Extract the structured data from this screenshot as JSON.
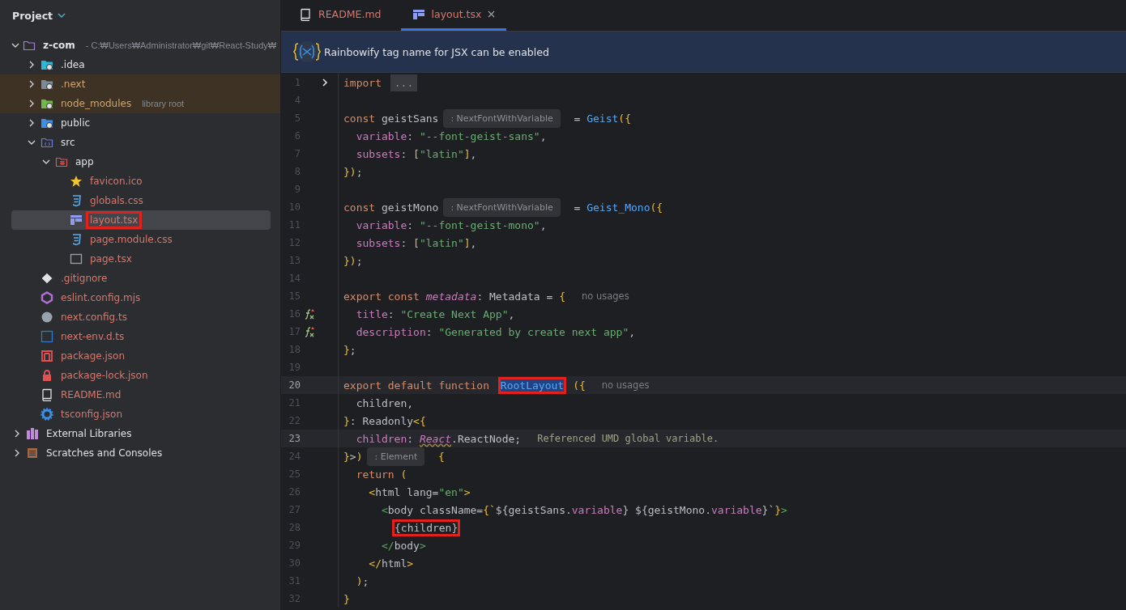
{
  "sidebar": {
    "title": "Project",
    "tree": [
      {
        "label": "z-com",
        "kind": "folder-module",
        "excluded": false,
        "untracked": false,
        "suffix": "- C:₩Users₩Administrator₩git₩React-Study₩",
        "expanded": true,
        "selected": false,
        "marked": false,
        "children": [
          {
            "label": ".idea",
            "kind": "folder-idea",
            "excluded": false,
            "untracked": false,
            "expanded": false,
            "selected": false,
            "marked": false
          },
          {
            "label": ".next",
            "kind": "folder-next",
            "excluded": true,
            "untracked": false,
            "expanded": false,
            "selected": false,
            "marked": false
          },
          {
            "label": "node_modules",
            "kind": "folder-lib",
            "excluded": true,
            "untracked": false,
            "suffix": "library root",
            "expanded": false,
            "selected": false,
            "marked": false
          },
          {
            "label": "public",
            "kind": "folder-web",
            "excluded": false,
            "untracked": false,
            "expanded": false,
            "selected": false,
            "marked": false
          },
          {
            "label": "src",
            "kind": "folder-src",
            "excluded": false,
            "untracked": false,
            "expanded": true,
            "selected": false,
            "marked": false,
            "children": [
              {
                "label": "app",
                "kind": "folder-app",
                "excluded": false,
                "untracked": false,
                "expanded": true,
                "selected": false,
                "marked": false,
                "children": [
                  {
                    "label": "favicon.ico",
                    "kind": "star",
                    "excluded": false,
                    "untracked": true,
                    "selected": false,
                    "marked": false
                  },
                  {
                    "label": "globals.css",
                    "kind": "css",
                    "excluded": false,
                    "untracked": true,
                    "selected": false,
                    "marked": false
                  },
                  {
                    "label": "layout.tsx",
                    "kind": "layout",
                    "excluded": false,
                    "untracked": true,
                    "selected": true,
                    "marked": true
                  },
                  {
                    "label": "page.module.css",
                    "kind": "css",
                    "excluded": false,
                    "untracked": true,
                    "selected": false,
                    "marked": false
                  },
                  {
                    "label": "page.tsx",
                    "kind": "page",
                    "excluded": false,
                    "untracked": true,
                    "selected": false,
                    "marked": false
                  }
                ]
              }
            ]
          },
          {
            "label": ".gitignore",
            "kind": "git",
            "excluded": false,
            "untracked": true,
            "selected": false,
            "marked": false
          },
          {
            "label": "eslint.config.mjs",
            "kind": "eslint",
            "excluded": false,
            "untracked": true,
            "selected": false,
            "marked": false
          },
          {
            "label": "next.config.ts",
            "kind": "next",
            "excluded": false,
            "untracked": true,
            "selected": false,
            "marked": false
          },
          {
            "label": "next-env.d.ts",
            "kind": "ts",
            "excluded": false,
            "untracked": true,
            "selected": false,
            "marked": false
          },
          {
            "label": "package.json",
            "kind": "npm",
            "excluded": false,
            "untracked": true,
            "selected": false,
            "marked": false
          },
          {
            "label": "package-lock.json",
            "kind": "lock",
            "excluded": false,
            "untracked": true,
            "selected": false,
            "marked": false
          },
          {
            "label": "README.md",
            "kind": "readme",
            "excluded": false,
            "untracked": true,
            "selected": false,
            "marked": false
          },
          {
            "label": "tsconfig.json",
            "kind": "tsconfig",
            "excluded": false,
            "untracked": true,
            "selected": false,
            "marked": false
          }
        ]
      },
      {
        "label": "External Libraries",
        "kind": "libraries",
        "excluded": false,
        "untracked": false,
        "expanded": false,
        "selected": false,
        "marked": false
      },
      {
        "label": "Scratches and Consoles",
        "kind": "scratches",
        "excluded": false,
        "untracked": false,
        "expanded": false,
        "selected": false,
        "marked": false
      }
    ]
  },
  "tabs": [
    {
      "label": "README.md",
      "kind": "readme",
      "selected": false,
      "closable": false
    },
    {
      "label": "layout.tsx",
      "kind": "layout",
      "selected": true,
      "closable": true
    }
  ],
  "banner": {
    "text": "Rainbowify tag name for JSX can be enabled"
  },
  "code": [
    {
      "number": "1",
      "foldable": true,
      "override": false,
      "current": false,
      "tokens": [
        {
          "kind": "kw",
          "text": "import "
        },
        {
          "kind": "fold",
          "text": "..."
        }
      ]
    },
    {
      "number": "4",
      "foldable": false,
      "override": false,
      "current": false
    },
    {
      "number": "5",
      "foldable": false,
      "override": false,
      "current": false,
      "tokens": [
        {
          "kind": "kw",
          "text": "const "
        },
        {
          "kind": "id",
          "text": "geistSans"
        },
        {
          "kind": "hint",
          "text": ": NextFontWithVariable"
        },
        {
          "kind": "id",
          "text": " = "
        },
        {
          "kind": "fn",
          "text": "Geist"
        },
        {
          "kind": "br",
          "text": "({"
        }
      ]
    },
    {
      "number": "6",
      "foldable": false,
      "override": false,
      "current": false,
      "tokens": [
        {
          "kind": "prop",
          "text": "  variable"
        },
        {
          "kind": "id",
          "text": ": "
        },
        {
          "kind": "str",
          "text": "\"--font-geist-sans\""
        },
        {
          "kind": "id",
          "text": ","
        }
      ]
    },
    {
      "number": "7",
      "foldable": false,
      "override": false,
      "current": false,
      "tokens": [
        {
          "kind": "prop",
          "text": "  subsets"
        },
        {
          "kind": "id",
          "text": ": "
        },
        {
          "kind": "br",
          "text": "["
        },
        {
          "kind": "str",
          "text": "\"latin\""
        },
        {
          "kind": "br",
          "text": "]"
        },
        {
          "kind": "id",
          "text": ","
        }
      ]
    },
    {
      "number": "8",
      "foldable": false,
      "override": false,
      "current": false,
      "tokens": [
        {
          "kind": "br",
          "text": "})"
        },
        {
          "kind": "id",
          "text": ";"
        }
      ]
    },
    {
      "number": "9",
      "foldable": false,
      "override": false,
      "current": false
    },
    {
      "number": "10",
      "foldable": false,
      "override": false,
      "current": false,
      "tokens": [
        {
          "kind": "kw",
          "text": "const "
        },
        {
          "kind": "id",
          "text": "geistMono"
        },
        {
          "kind": "hint",
          "text": ": NextFontWithVariable"
        },
        {
          "kind": "id",
          "text": " = "
        },
        {
          "kind": "fn",
          "text": "Geist_Mono"
        },
        {
          "kind": "br",
          "text": "({"
        }
      ]
    },
    {
      "number": "11",
      "foldable": false,
      "override": false,
      "current": false,
      "tokens": [
        {
          "kind": "prop",
          "text": "  variable"
        },
        {
          "kind": "id",
          "text": ": "
        },
        {
          "kind": "str",
          "text": "\"--font-geist-mono\""
        },
        {
          "kind": "id",
          "text": ","
        }
      ]
    },
    {
      "number": "12",
      "foldable": false,
      "override": false,
      "current": false,
      "tokens": [
        {
          "kind": "prop",
          "text": "  subsets"
        },
        {
          "kind": "id",
          "text": ": "
        },
        {
          "kind": "br",
          "text": "["
        },
        {
          "kind": "str",
          "text": "\"latin\""
        },
        {
          "kind": "br",
          "text": "]"
        },
        {
          "kind": "id",
          "text": ","
        }
      ]
    },
    {
      "number": "13",
      "foldable": false,
      "override": false,
      "current": false,
      "tokens": [
        {
          "kind": "br",
          "text": "})"
        },
        {
          "kind": "id",
          "text": ";"
        }
      ]
    },
    {
      "number": "14",
      "foldable": false,
      "override": false,
      "current": false
    },
    {
      "number": "15",
      "foldable": false,
      "override": false,
      "current": false,
      "tokens": [
        {
          "kind": "kw",
          "text": "export const "
        },
        {
          "kind": "it",
          "text": "metadata"
        },
        {
          "kind": "id",
          "text": ": Metadata = "
        },
        {
          "kind": "br",
          "text": "{"
        },
        {
          "kind": "usage",
          "text": "no usages"
        }
      ]
    },
    {
      "number": "16",
      "foldable": false,
      "override": true,
      "current": false,
      "tokens": [
        {
          "kind": "prop",
          "text": "  title"
        },
        {
          "kind": "id",
          "text": ": "
        },
        {
          "kind": "str",
          "text": "\"Create Next App\""
        },
        {
          "kind": "id",
          "text": ","
        }
      ]
    },
    {
      "number": "17",
      "foldable": false,
      "override": true,
      "current": false,
      "tokens": [
        {
          "kind": "prop",
          "text": "  description"
        },
        {
          "kind": "id",
          "text": ": "
        },
        {
          "kind": "str",
          "text": "\"Generated by create next app\""
        },
        {
          "kind": "id",
          "text": ","
        }
      ]
    },
    {
      "number": "18",
      "foldable": false,
      "override": false,
      "current": false,
      "tokens": [
        {
          "kind": "br",
          "text": "}"
        },
        {
          "kind": "id",
          "text": ";"
        }
      ]
    },
    {
      "number": "19",
      "foldable": false,
      "override": false,
      "current": false
    },
    {
      "number": "20",
      "foldable": false,
      "override": false,
      "current": true,
      "tokens": [
        {
          "kind": "kw",
          "text": "export default function "
        },
        {
          "kind": "sel",
          "text": "RootLayout",
          "marked": true
        },
        {
          "kind": "br",
          "text": "({"
        },
        {
          "kind": "usage",
          "text": "no usages"
        }
      ]
    },
    {
      "number": "21",
      "foldable": false,
      "override": false,
      "current": false,
      "tokens": [
        {
          "kind": "id",
          "text": "  children,"
        }
      ]
    },
    {
      "number": "22",
      "foldable": false,
      "override": false,
      "current": false,
      "tokens": [
        {
          "kind": "br",
          "text": "}"
        },
        {
          "kind": "id",
          "text": ": Readonly"
        },
        {
          "kind": "br",
          "text": "<{"
        }
      ]
    },
    {
      "number": "23",
      "foldable": false,
      "override": false,
      "current": true,
      "tokens": [
        {
          "kind": "prop",
          "text": "  children"
        },
        {
          "kind": "id",
          "text": ": "
        },
        {
          "kind": "warn",
          "text": "React"
        },
        {
          "kind": "id",
          "text": ".ReactNode;"
        },
        {
          "kind": "note",
          "text": "Referenced UMD global variable."
        }
      ]
    },
    {
      "number": "24",
      "foldable": false,
      "override": false,
      "current": false,
      "tokens": [
        {
          "kind": "br",
          "text": "}"
        },
        {
          "kind": "id",
          "text": ">"
        },
        {
          "kind": "br",
          "text": ")"
        },
        {
          "kind": "hint",
          "text": ": Element"
        },
        {
          "kind": "br",
          "text": " {"
        }
      ]
    },
    {
      "number": "25",
      "foldable": false,
      "override": false,
      "current": false,
      "tokens": [
        {
          "kind": "kw",
          "text": "  return "
        },
        {
          "kind": "br",
          "text": "("
        }
      ]
    },
    {
      "number": "26",
      "foldable": false,
      "override": false,
      "current": false,
      "tokens": [
        {
          "kind": "br",
          "text": "    <"
        },
        {
          "kind": "id",
          "text": "html lang="
        },
        {
          "kind": "str",
          "text": "\"en\""
        },
        {
          "kind": "br",
          "text": ">"
        }
      ]
    },
    {
      "number": "27",
      "foldable": false,
      "override": false,
      "current": false,
      "tokens": [
        {
          "kind": "brg",
          "text": "      <"
        },
        {
          "kind": "id",
          "text": "body className="
        },
        {
          "kind": "br",
          "text": "{`"
        },
        {
          "kind": "id",
          "text": "${geistSans."
        },
        {
          "kind": "prop",
          "text": "variable"
        },
        {
          "kind": "id",
          "text": "} ${geistMono."
        },
        {
          "kind": "prop",
          "text": "variable"
        },
        {
          "kind": "id",
          "text": "}`"
        },
        {
          "kind": "br",
          "text": "}"
        },
        {
          "kind": "brg",
          "text": ">"
        }
      ]
    },
    {
      "number": "28",
      "foldable": false,
      "override": false,
      "current": false,
      "indented": true,
      "tokens": [
        {
          "kind": "id",
          "text": "{children}",
          "marked": true
        }
      ]
    },
    {
      "number": "29",
      "foldable": false,
      "override": false,
      "current": false,
      "tokens": [
        {
          "kind": "brg",
          "text": "      </"
        },
        {
          "kind": "id",
          "text": "body"
        },
        {
          "kind": "brg",
          "text": ">"
        }
      ]
    },
    {
      "number": "30",
      "foldable": false,
      "override": false,
      "current": false,
      "tokens": [
        {
          "kind": "br",
          "text": "    </"
        },
        {
          "kind": "id",
          "text": "html"
        },
        {
          "kind": "br",
          "text": ">"
        }
      ]
    },
    {
      "number": "31",
      "foldable": false,
      "override": false,
      "current": false,
      "tokens": [
        {
          "kind": "br",
          "text": "  )"
        },
        {
          "kind": "id",
          "text": ";"
        }
      ]
    },
    {
      "number": "32",
      "foldable": false,
      "override": false,
      "current": false,
      "tokens": [
        {
          "kind": "br",
          "text": "}"
        }
      ]
    }
  ]
}
